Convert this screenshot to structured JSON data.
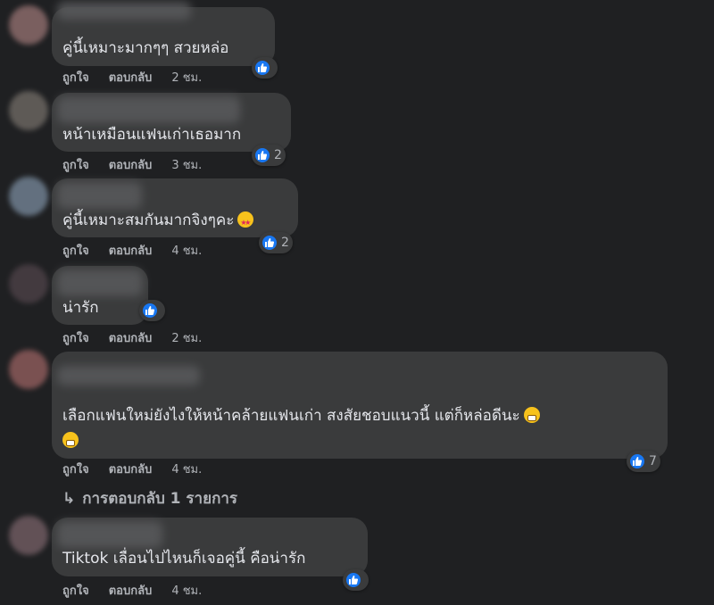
{
  "comments": [
    {
      "text": "คู่นี้เหมาะมากๆๆ สวยหล่อ",
      "author_hint": "Nitchu Birchie",
      "reaction_count": "",
      "actions": {
        "like": "ถูกใจ",
        "reply": "ตอบกลับ",
        "time": "2 ชม."
      }
    },
    {
      "text": "หน้าเหมือนแฟนเก่าเธอมาก",
      "reaction_count": "2",
      "actions": {
        "like": "ถูกใจ",
        "reply": "ตอบกลับ",
        "time": "3 ชม."
      }
    },
    {
      "text": "คู่นี้เหมาะสมกันมากจิงๆคะ",
      "emoji": "star-struck",
      "reaction_count": "2",
      "actions": {
        "like": "ถูกใจ",
        "reply": "ตอบกลับ",
        "time": "4 ชม."
      }
    },
    {
      "text": "น่ารัก",
      "reaction_count": "",
      "actions": {
        "like": "ถูกใจ",
        "reply": "ตอบกลับ",
        "time": "2 ชม."
      }
    },
    {
      "text_line1": "เลือกแฟนใหม่ยังไงให้หน้าคล้ายแฟนเก่า สงสัยชอบแนวนี้ แต่ก็หล่อดีนะ",
      "emoji": "grimacing",
      "reaction_count": "7",
      "actions": {
        "like": "ถูกใจ",
        "reply": "ตอบกลับ",
        "time": "4 ชม."
      },
      "replies_label": "การตอบกลับ 1 รายการ"
    },
    {
      "text": "Tiktok เลื่อนไปไหนก็เจอคู่นี้ คือน่ารัก",
      "reaction_count": "",
      "actions": {
        "like": "ถูกใจ",
        "reply": "ตอบกลับ",
        "time": "4 ชม."
      }
    }
  ],
  "colors": {
    "background": "#1f2022",
    "bubble": "#3a3b3c",
    "text": "#e4e6eb",
    "muted": "#b0b3b8",
    "like_blue": "#1877f2"
  },
  "icons": {
    "like": "thumbs-up-icon",
    "reply_arrow": "reply-arrow-icon"
  }
}
